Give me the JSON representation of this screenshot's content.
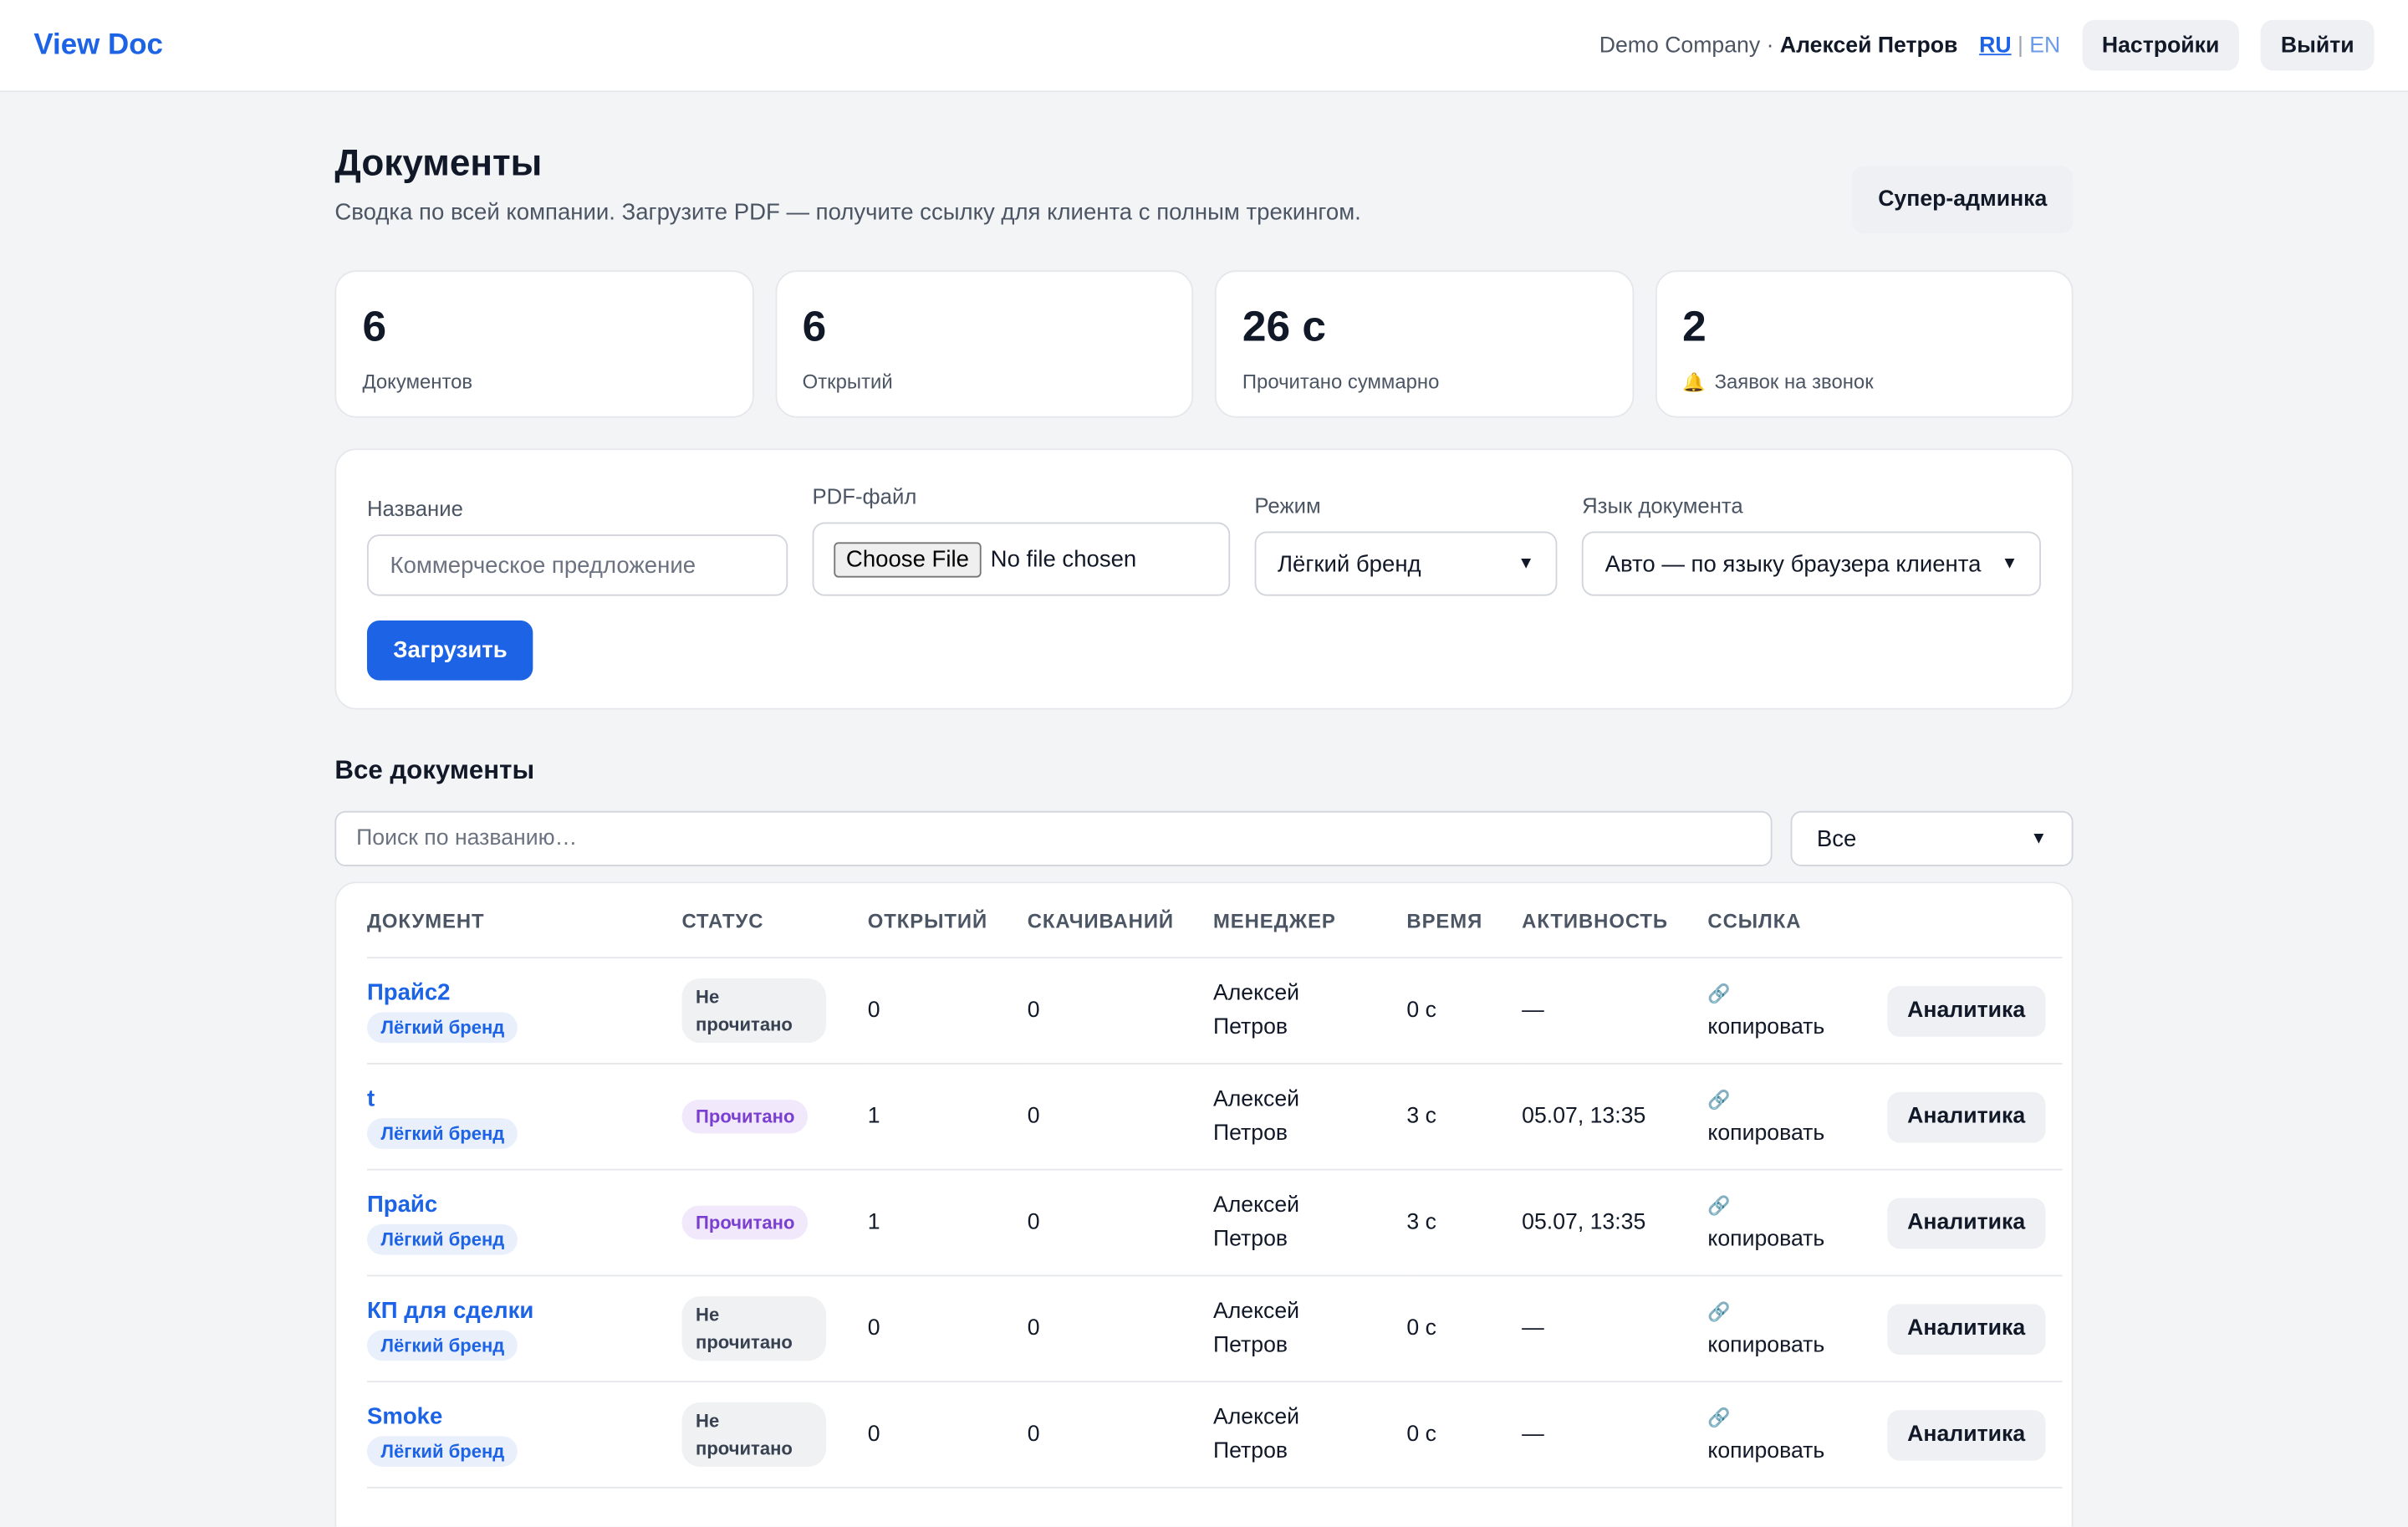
{
  "header": {
    "brand": "View Doc",
    "company": "Demo Company",
    "separator": "·",
    "user": "Алексей Петров",
    "lang_ru": "RU",
    "lang_sep": "|",
    "lang_en": "EN",
    "settings": "Настройки",
    "logout": "Выйти"
  },
  "page": {
    "title": "Документы",
    "subtitle": "Сводка по всей компании. Загрузите PDF — получите ссылку для клиента с полным трекингом.",
    "super_admin": "Супер-админка"
  },
  "stats": [
    {
      "value": "6",
      "label": "Документов"
    },
    {
      "value": "6",
      "label": "Открытий"
    },
    {
      "value": "26 с",
      "label": "Прочитано суммарно"
    },
    {
      "value": "2",
      "label": "Заявок на звонок",
      "icon": "bell-icon"
    }
  ],
  "upload": {
    "name_label": "Название",
    "name_placeholder": "Коммерческое предложение",
    "file_label": "PDF-файл",
    "file_button": "Choose File",
    "file_status": "No file chosen",
    "mode_label": "Режим",
    "mode_value": "Лёгкий бренд",
    "lang_label": "Язык документа",
    "lang_value": "Авто — по языку браузера клиента",
    "submit": "Загрузить"
  },
  "list": {
    "title": "Все документы",
    "search_placeholder": "Поиск по названию…",
    "filter_value": "Все",
    "columns": [
      "ДОКУМЕНТ",
      "СТАТУС",
      "ОТКРЫТИЙ",
      "СКАЧИВАНИЙ",
      "МЕНЕДЖЕР",
      "ВРЕМЯ",
      "АКТИВНОСТЬ",
      "ССЫЛКА"
    ],
    "rows": [
      {
        "name": "Прайс2",
        "tag": "Лёгкий бренд",
        "status": "Не прочитано",
        "status_kind": "unread",
        "opens": "0",
        "downloads": "0",
        "manager_first": "Алексей",
        "manager_last": "Петров",
        "time": "0 с",
        "activity": "—",
        "link": "копировать",
        "action": "Аналитика"
      },
      {
        "name": "t",
        "tag": "Лёгкий бренд",
        "status": "Прочитано",
        "status_kind": "read",
        "opens": "1",
        "downloads": "0",
        "manager_first": "Алексей",
        "manager_last": "Петров",
        "time": "3 с",
        "activity": "05.07, 13:35",
        "link": "копировать",
        "action": "Аналитика"
      },
      {
        "name": "Прайс",
        "tag": "Лёгкий бренд",
        "status": "Прочитано",
        "status_kind": "read",
        "opens": "1",
        "downloads": "0",
        "manager_first": "Алексей",
        "manager_last": "Петров",
        "time": "3 с",
        "activity": "05.07, 13:35",
        "link": "копировать",
        "action": "Аналитика"
      },
      {
        "name": "КП для сделки",
        "tag": "Лёгкий бренд",
        "status": "Не прочитано",
        "status_kind": "unread",
        "opens": "0",
        "downloads": "0",
        "manager_first": "Алексей",
        "manager_last": "Петров",
        "time": "0 с",
        "activity": "—",
        "link": "копировать",
        "action": "Аналитика"
      },
      {
        "name": "Smoke",
        "tag": "Лёгкий бренд",
        "status": "Не прочитано",
        "status_kind": "unread",
        "opens": "0",
        "downloads": "0",
        "manager_first": "Алексей",
        "manager_last": "Петров",
        "time": "0 с",
        "activity": "—",
        "link": "копировать",
        "action": "Аналитика"
      }
    ]
  }
}
